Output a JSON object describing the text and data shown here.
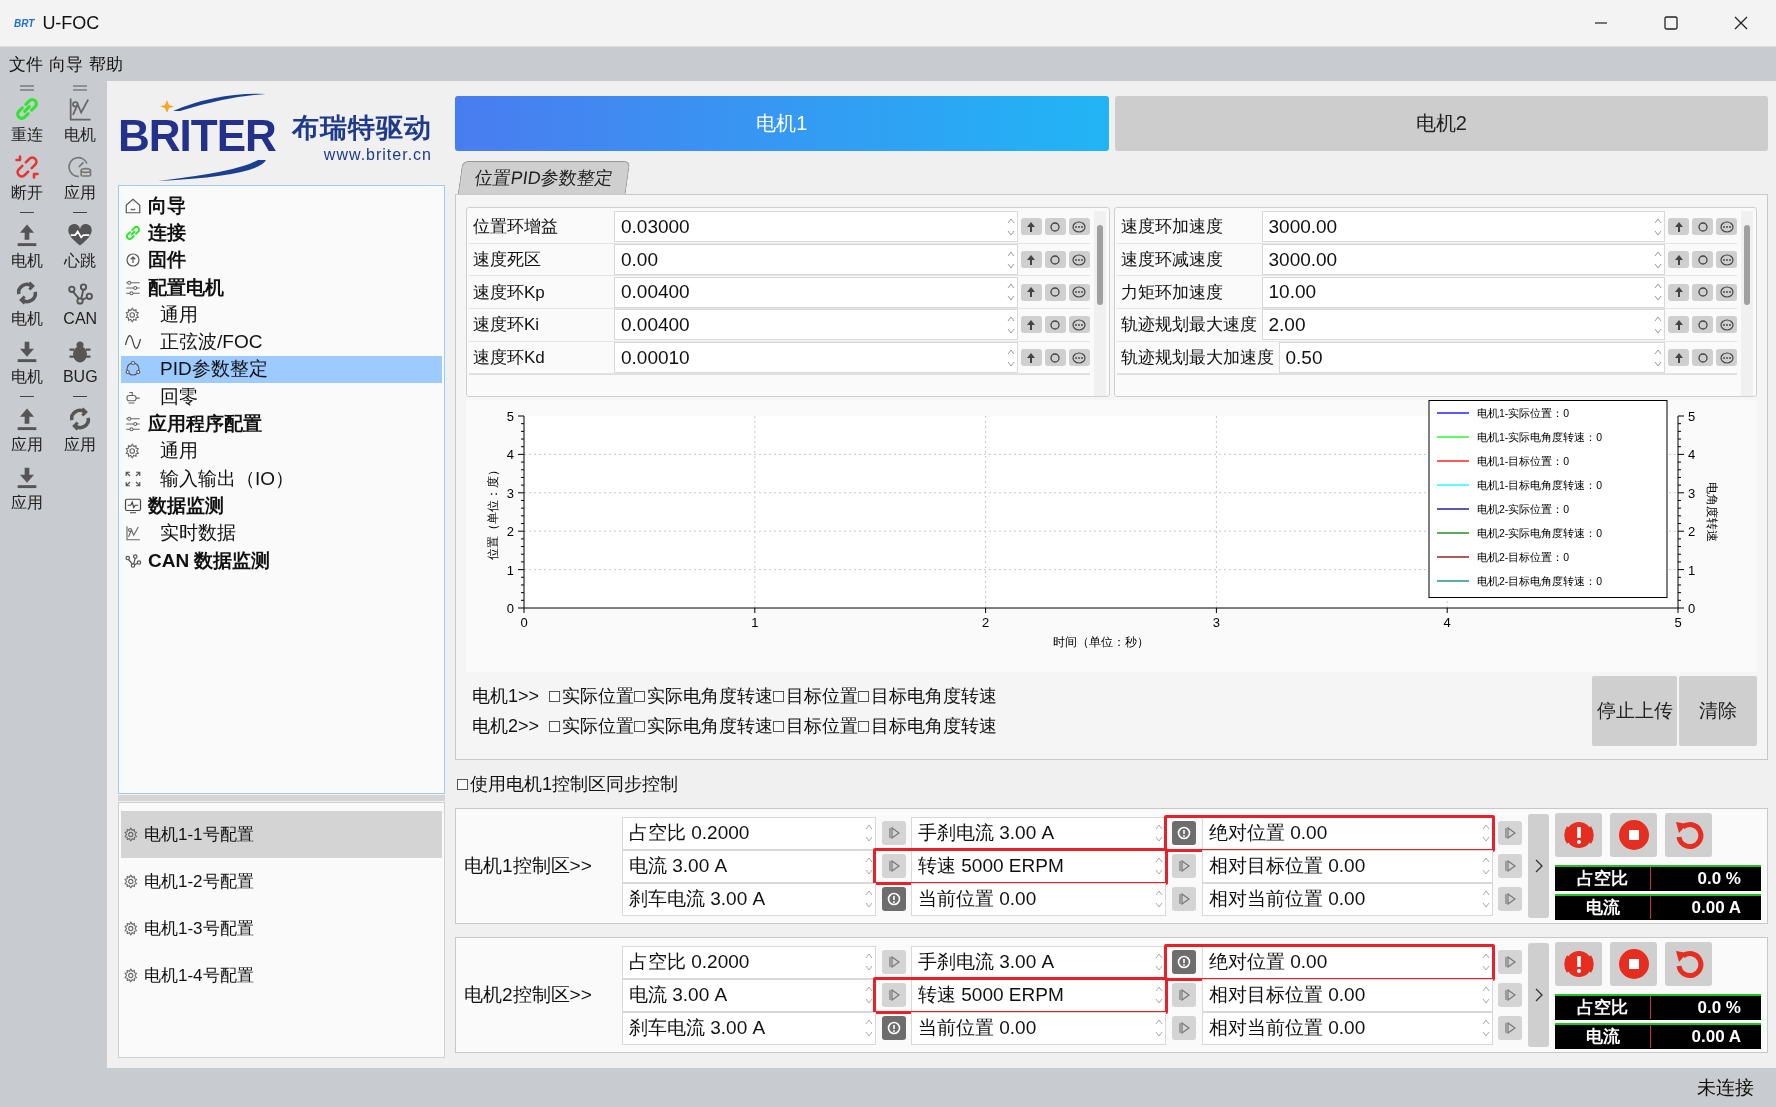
{
  "window": {
    "app_icon": "BRT",
    "title": "U-FOC"
  },
  "menu": [
    "文件",
    "向导",
    "帮助"
  ],
  "toolbar": [
    {
      "items": [
        {
          "kind": "link",
          "label": "重连"
        },
        {
          "kind": "chart",
          "label": "电机"
        },
        {
          "kind": "unlink",
          "label": "断开"
        },
        {
          "kind": "gauge",
          "label": "应用"
        }
      ]
    },
    {
      "items": [
        {
          "kind": "upload",
          "label": "电机"
        },
        {
          "kind": "heart",
          "label": "心跳"
        },
        {
          "kind": "refresh",
          "label": "电机"
        },
        {
          "kind": "nodes",
          "label": "CAN"
        },
        {
          "kind": "download",
          "label": "电机"
        },
        {
          "kind": "bug",
          "label": "BUG"
        }
      ]
    },
    {
      "items": [
        {
          "kind": "upload",
          "label": "应用"
        },
        {
          "kind": "refresh",
          "label": "应用"
        },
        {
          "kind": "download",
          "label": "应用"
        }
      ]
    }
  ],
  "logo": {
    "wordmark": "BRITER",
    "name": "布瑞特驱动",
    "url": "www.briter.cn"
  },
  "nav": [
    {
      "label": "向导",
      "kind": "home",
      "selected": false
    },
    {
      "label": "连接",
      "kind": "link",
      "selected": false
    },
    {
      "label": "固件",
      "kind": "chip",
      "selected": false
    },
    {
      "label": "配置电机",
      "kind": "sliders",
      "selected": false,
      "children": [
        {
          "label": "通用",
          "kind": "gear",
          "selected": false
        },
        {
          "label": "正弦波/FOC",
          "kind": "wave",
          "selected": false
        },
        {
          "label": "PID参数整定",
          "kind": "cycle",
          "selected": true
        },
        {
          "label": "回零",
          "kind": "zero",
          "selected": false
        }
      ]
    },
    {
      "label": "应用程序配置",
      "kind": "sliders",
      "selected": false,
      "children": [
        {
          "label": "通用",
          "kind": "gear",
          "selected": false
        },
        {
          "label": "输入输出（IO）",
          "kind": "expand",
          "selected": false
        }
      ]
    },
    {
      "label": "数据监测",
      "kind": "monitor",
      "selected": false,
      "children": [
        {
          "label": "实时数据",
          "kind": "chart",
          "selected": false
        }
      ]
    },
    {
      "label": "CAN 数据监测",
      "kind": "nodes",
      "selected": false
    }
  ],
  "configs": [
    {
      "label": "电机1-1号配置",
      "selected": true
    },
    {
      "label": "电机1-2号配置",
      "selected": false
    },
    {
      "label": "电机1-3号配置",
      "selected": false
    },
    {
      "label": "电机1-4号配置",
      "selected": false
    }
  ],
  "motor_tabs": [
    {
      "label": "电机1",
      "selected": true
    },
    {
      "label": "电机2",
      "selected": false
    }
  ],
  "sub_tabs": [
    {
      "label": "位置PID参数整定",
      "selected": true
    }
  ],
  "params_left": [
    {
      "label": "位置环增益",
      "value": "0.03000"
    },
    {
      "label": "速度死区",
      "value": "0.00"
    },
    {
      "label": "速度环Kp",
      "value": "0.00400"
    },
    {
      "label": "速度环Ki",
      "value": "0.00400"
    },
    {
      "label": "速度环Kd",
      "value": "0.00010"
    }
  ],
  "params_right": [
    {
      "label": "速度环加速度",
      "value": "3000.00"
    },
    {
      "label": "速度环减速度",
      "value": "3000.00"
    },
    {
      "label": "力矩环加速度",
      "value": "10.00"
    },
    {
      "label": "轨迹规划最大速度",
      "value": "2.00"
    },
    {
      "label": "轨迹规划最大加速度",
      "value": "0.50"
    }
  ],
  "chart": {
    "chart_data": {
      "type": "line",
      "xlabel": "时间（单位：秒）",
      "ylabel": "位置（单位：度）",
      "y2label": "电角度转速",
      "categories": [
        "0",
        "1",
        "2",
        "3",
        "4",
        "5"
      ],
      "ylim": [
        0,
        5
      ],
      "yticks": [
        0,
        1,
        2,
        3,
        4,
        5
      ],
      "y2lim": [
        0,
        5
      ],
      "y2ticks": [
        0,
        1,
        2,
        3,
        4,
        5
      ],
      "grid": true,
      "series": [
        {
          "name": "电机1-实际位置：0",
          "color": "#0000ff",
          "values": [
            null,
            null,
            null,
            null,
            null,
            null
          ]
        },
        {
          "name": "电机1-实际电角度转速：0",
          "color": "#00ff00",
          "values": [
            null,
            null,
            null,
            null,
            null,
            null
          ]
        },
        {
          "name": "电机1-目标位置：0",
          "color": "#ff0000",
          "values": [
            null,
            null,
            null,
            null,
            null,
            null
          ]
        },
        {
          "name": "电机1-目标电角度转速：0",
          "color": "#00ffff",
          "values": [
            null,
            null,
            null,
            null,
            null,
            null
          ]
        },
        {
          "name": "电机2-实际位置：0",
          "color": "#000080",
          "values": [
            null,
            null,
            null,
            null,
            null,
            null
          ]
        },
        {
          "name": "电机2-实际电角度转速：0",
          "color": "#008000",
          "values": [
            null,
            null,
            null,
            null,
            null,
            null
          ]
        },
        {
          "name": "电机2-目标位置：0",
          "color": "#800000",
          "values": [
            null,
            null,
            null,
            null,
            null,
            null
          ]
        },
        {
          "name": "电机2-目标电角度转速：0",
          "color": "#008080",
          "values": [
            null,
            null,
            null,
            null,
            null,
            null
          ]
        }
      ]
    }
  },
  "plot_toggles": [
    {
      "label": "电机1>>",
      "options": [
        {
          "label": "实际位置",
          "checked": false
        },
        {
          "label": "实际电角度转速",
          "checked": false
        },
        {
          "label": "目标位置",
          "checked": false
        },
        {
          "label": "目标电角度转速",
          "checked": false
        }
      ]
    },
    {
      "label": "电机2>>",
      "options": [
        {
          "label": "实际位置",
          "checked": false
        },
        {
          "label": "实际电角度转速",
          "checked": false
        },
        {
          "label": "目标位置",
          "checked": false
        },
        {
          "label": "目标电角度转速",
          "checked": false
        }
      ]
    }
  ],
  "plot_buttons": [
    "停止上传",
    "清除"
  ],
  "sync": {
    "label": "使用电机1控制区同步控制",
    "checked": false
  },
  "zones": [
    {
      "label": "电机1控制区>>",
      "fields": [
        {
          "text": "占空比 0.2000",
          "kind": "play",
          "highlighted": false
        },
        {
          "text": "手刹电流 3.00 A",
          "kind": "brake",
          "highlighted": false
        },
        {
          "text": "绝对位置 0.00",
          "kind": "play",
          "highlighted": true
        },
        {
          "text": "电流 3.00 A",
          "kind": "play",
          "highlighted": false
        },
        {
          "text": "转速 5000 ERPM",
          "kind": "play",
          "highlighted": true
        },
        {
          "text": "相对目标位置 0.00",
          "kind": "play",
          "highlighted": false
        },
        {
          "text": "刹车电流 3.00 A",
          "kind": "brake",
          "highlighted": false
        },
        {
          "text": "当前位置 0.00",
          "kind": "play",
          "highlighted": false
        },
        {
          "text": "相对当前位置 0.00",
          "kind": "play",
          "highlighted": false
        }
      ],
      "meters": [
        {
          "label": "占空比",
          "reading": "0.0 %"
        },
        {
          "label": "电流",
          "reading": "0.00 A"
        }
      ]
    },
    {
      "label": "电机2控制区>>",
      "fields": [
        {
          "text": "占空比 0.2000",
          "kind": "play",
          "highlighted": false
        },
        {
          "text": "手刹电流 3.00 A",
          "kind": "brake",
          "highlighted": false
        },
        {
          "text": "绝对位置 0.00",
          "kind": "play",
          "highlighted": true
        },
        {
          "text": "电流 3.00 A",
          "kind": "play",
          "highlighted": false
        },
        {
          "text": "转速 5000 ERPM",
          "kind": "play",
          "highlighted": true
        },
        {
          "text": "相对目标位置 0.00",
          "kind": "play",
          "highlighted": false
        },
        {
          "text": "刹车电流 3.00 A",
          "kind": "brake",
          "highlighted": false
        },
        {
          "text": "当前位置 0.00",
          "kind": "play",
          "highlighted": false
        },
        {
          "text": "相对当前位置 0.00",
          "kind": "play",
          "highlighted": false
        }
      ],
      "meters": [
        {
          "label": "占空比",
          "reading": "0.0 %"
        },
        {
          "label": "电流",
          "reading": "0.00 A"
        }
      ]
    }
  ],
  "status": "未连接"
}
